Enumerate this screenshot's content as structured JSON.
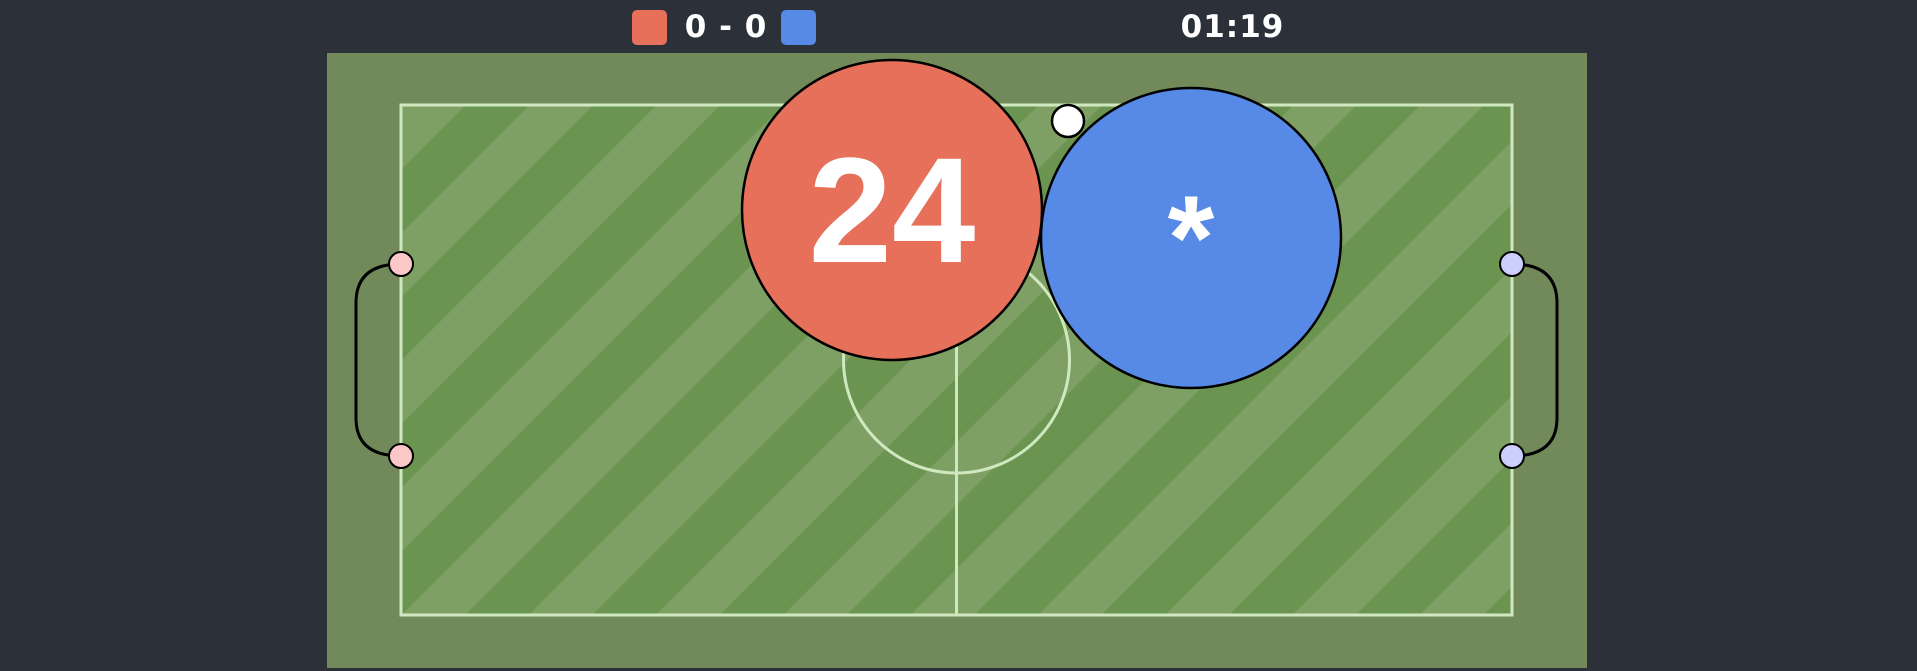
{
  "scoreboard": {
    "red_score": "0",
    "separator": "-",
    "blue_score": "0",
    "timer": "01:19"
  },
  "colors": {
    "background": "#2b3039",
    "field_border": "#728a5a",
    "grass_light": "#7fa065",
    "grass_dark": "#6b9450",
    "line": "#cfe8c0",
    "red_team": "#e6705a",
    "blue_team": "#5789e6",
    "red_post": "#fcc7c7",
    "blue_post": "#cccefc",
    "ball": "#ffffff",
    "net": "#000000"
  },
  "players": {
    "red": {
      "label": "24",
      "team": "red"
    },
    "blue": {
      "label": "*",
      "team": "blue"
    }
  },
  "icons": {
    "ball": "ball-icon",
    "red_goal": "red-goal-icon",
    "blue_goal": "blue-goal-icon"
  }
}
